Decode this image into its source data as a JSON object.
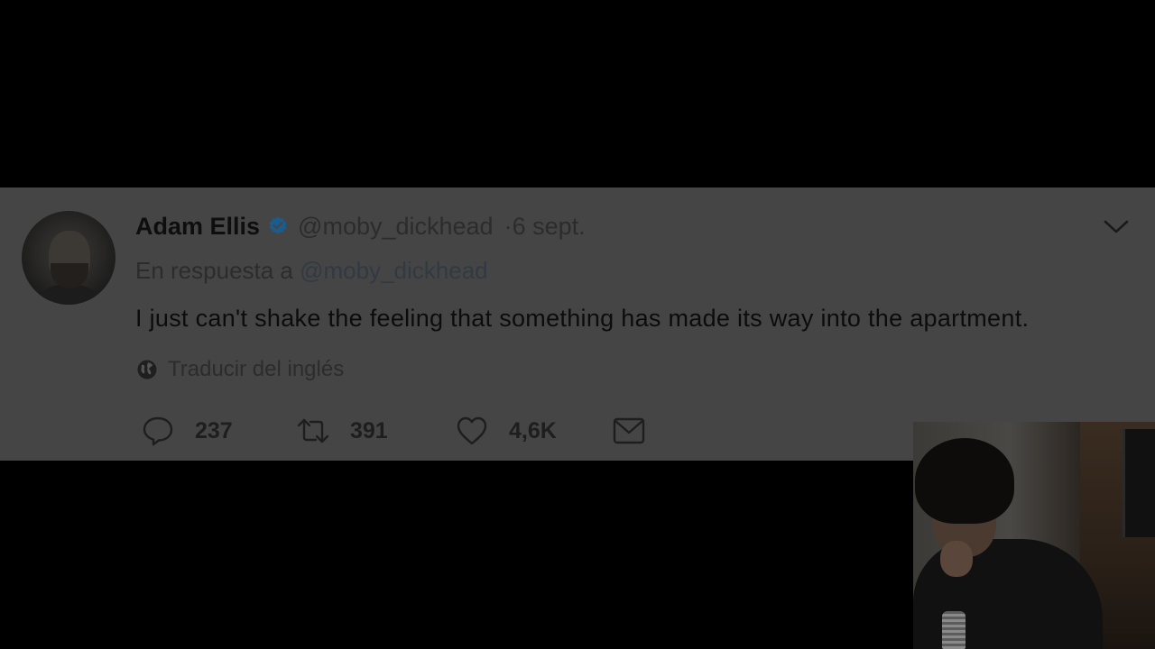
{
  "tweet": {
    "author_name": "Adam Ellis",
    "handle": "@moby_dickhead",
    "date": "·6 sept.",
    "reply_prefix": "En respuesta a",
    "reply_handle": "@moby_dickhead",
    "text": "I just can't shake the feeling that something has made its way into the apartment.",
    "translate_label": "Traducir del inglés",
    "actions": {
      "replies": "237",
      "retweets": "391",
      "likes": "4,6K"
    }
  },
  "icons": {
    "verified": "verified-badge-icon",
    "menu": "chevron-down-icon",
    "translate": "globe-icon",
    "reply": "reply-icon",
    "retweet": "retweet-icon",
    "like": "heart-icon",
    "message": "envelope-icon"
  },
  "colors": {
    "verified_badge": "#1b5c8c",
    "card_background": "#454545",
    "page_background": "#000000"
  }
}
